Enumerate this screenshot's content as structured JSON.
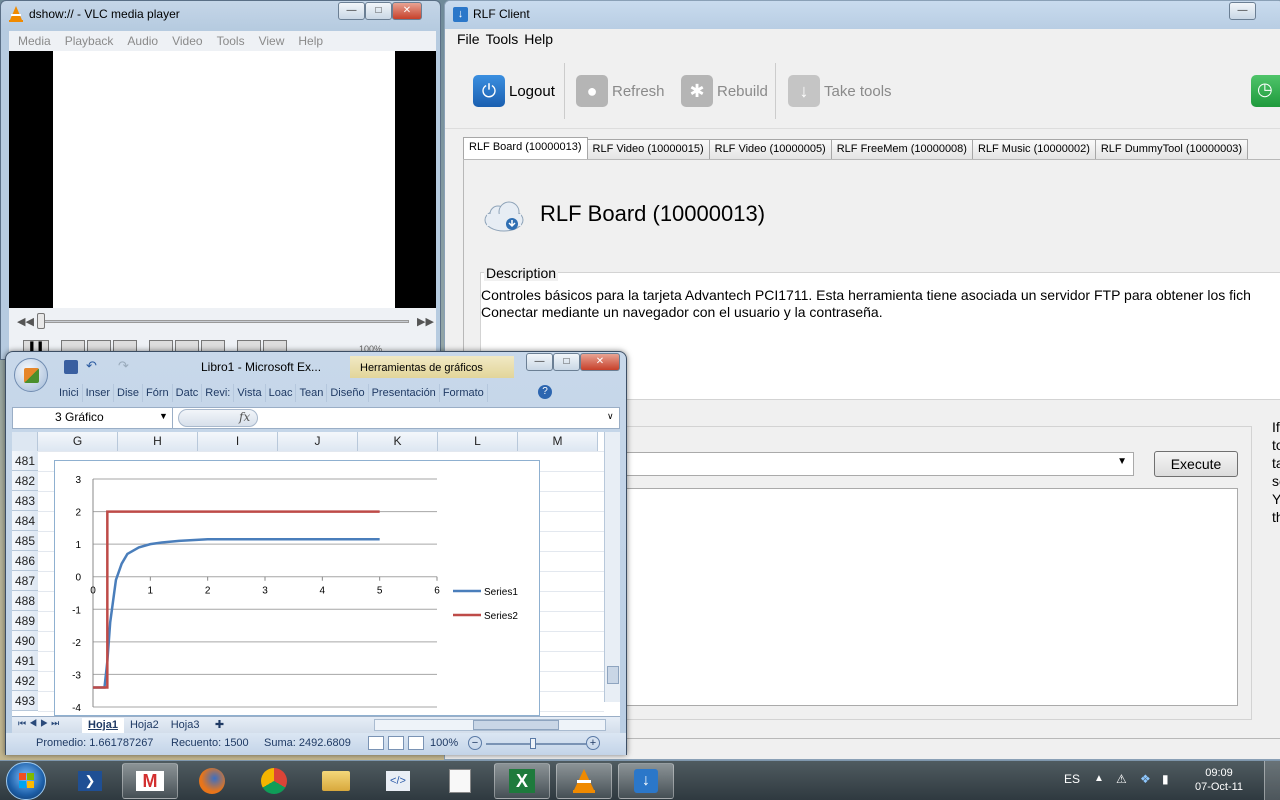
{
  "vlc": {
    "title": "dshow:// - VLC media player",
    "menu": [
      "Media",
      "Playback",
      "Audio",
      "Video",
      "Tools",
      "View",
      "Help"
    ],
    "volume": "100%"
  },
  "rlf": {
    "title": "RLF Client",
    "menu": [
      "File",
      "Tools",
      "Help"
    ],
    "toolbar": {
      "logout": "Logout",
      "refresh": "Refresh",
      "rebuild": "Rebuild",
      "take_tools": "Take tools"
    },
    "tabs": [
      "RLF Board (10000013)",
      "RLF Video (10000015)",
      "RLF Video (10000005)",
      "RLF FreeMem (10000008)",
      "RLF Music (10000002)",
      "RLF DummyTool (10000003)"
    ],
    "tool_title": "RLF Board (10000013)",
    "description_label": "Description",
    "description_lines": [
      "Controles básicos para la tarjeta Advantech PCI1711. Esta herramienta tiene asociada un servidor FTP para obtener los fich",
      "Conectar mediante un navegador con el usuario y la contraseña."
    ],
    "execute_label": "Execute",
    "side_text": [
      "If",
      "to",
      "ta",
      "se",
      "Y",
      "th"
    ]
  },
  "excel": {
    "title": "Libro1 - Microsoft Ex...",
    "context_title": "Herramientas de gráficos",
    "ribbon_tabs": [
      "Inici",
      "Inser",
      "Dise",
      "Fórn",
      "Datc",
      "Revi:",
      "Vista",
      "Loac",
      "Tean",
      "Diseño",
      "Presentación",
      "Formato"
    ],
    "name_box": "3 Gráfico",
    "fx": "fx",
    "columns": [
      "G",
      "H",
      "I",
      "J",
      "K",
      "L",
      "M"
    ],
    "rows": [
      "481",
      "482",
      "483",
      "484",
      "485",
      "486",
      "487",
      "488",
      "489",
      "490",
      "491",
      "492",
      "493"
    ],
    "sheets": [
      "Hoja1",
      "Hoja2",
      "Hoja3"
    ],
    "status": {
      "avg": "Promedio: 1.661787267",
      "count": "Recuento: 1500",
      "sum": "Suma: 2492.6809",
      "zoom": "100%"
    }
  },
  "chart_data": {
    "type": "line",
    "title": "",
    "xlabel": "",
    "ylabel": "",
    "xlim": [
      0,
      6
    ],
    "ylim": [
      -4,
      3
    ],
    "x_ticks": [
      "0",
      "1",
      "2",
      "3",
      "4",
      "5",
      "6"
    ],
    "y_ticks": [
      "3",
      "2",
      "1",
      "0",
      "-1",
      "-2",
      "-3",
      "-4"
    ],
    "legend_position": "right",
    "series": [
      {
        "name": "Series1",
        "color": "#4a7ebb",
        "x": [
          0,
          0.1,
          0.2,
          0.25,
          0.3,
          0.4,
          0.5,
          0.6,
          0.8,
          1.0,
          1.2,
          1.5,
          2.0,
          2.5,
          3.0,
          4.0,
          5.0
        ],
        "y": [
          -3.4,
          -3.4,
          -3.4,
          -2.6,
          -1.4,
          -0.1,
          0.4,
          0.7,
          0.9,
          1.0,
          1.05,
          1.1,
          1.15,
          1.15,
          1.15,
          1.15,
          1.15
        ]
      },
      {
        "name": "Series2",
        "color": "#be4b48",
        "x": [
          0,
          0.25,
          0.25,
          5.0
        ],
        "y": [
          -3.4,
          -3.4,
          2.0,
          2.0
        ]
      }
    ]
  },
  "taskbar": {
    "lang": "ES",
    "time": "09:09",
    "date": "07-Oct-11",
    "apps": [
      "powershell-icon",
      "gmail-icon",
      "firefox-icon",
      "chrome-icon",
      "explorer-icon",
      "xml-icon",
      "notepad-icon",
      "excel-icon",
      "vlc-icon",
      "rlf-client-icon"
    ]
  }
}
